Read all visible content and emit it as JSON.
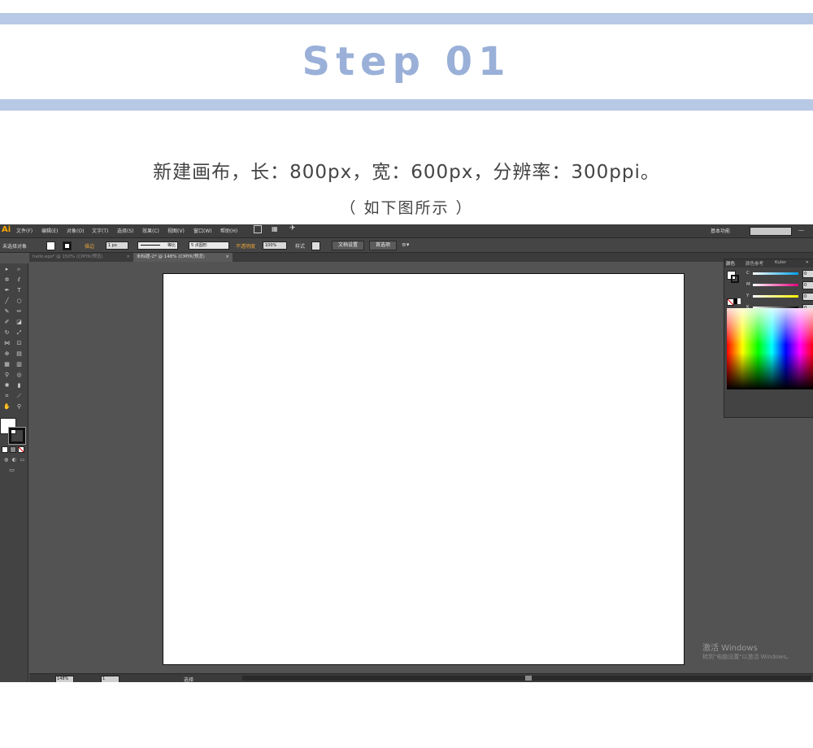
{
  "header": {
    "title": "Step 01",
    "instruction": "新建画布，长：800px，宽：600px，分辨率：300ppi。",
    "caption": "（ 如下图所示 ）"
  },
  "colors": {
    "band": "#b8c9e6",
    "title": "#9ab0d8"
  },
  "app": {
    "logo": "Ai",
    "menu": [
      "文件(F)",
      "编辑(E)",
      "对象(O)",
      "文字(T)",
      "选择(S)",
      "效果(C)",
      "视图(V)",
      "窗口(W)",
      "帮助(H)"
    ],
    "workspace": "基本功能",
    "minimize_symbol": "—",
    "control": {
      "selection": "未选择对象",
      "stroke_label": "描边",
      "stroke_weight": "1 px",
      "stroke_profile": "等比",
      "brush": "5 点圆形",
      "opacity_label": "不透明度",
      "opacity": "100%",
      "style_label": "样式",
      "doc_setup": "文档设置",
      "preferences": "首选项"
    },
    "tabs": [
      {
        "label": "hello.eps* @ 150% (CMYK/预览)",
        "close": "×",
        "active": false
      },
      {
        "label": "未标题-2* @ 148% (CMYK/预览)",
        "close": "×",
        "active": true
      }
    ],
    "color_panel": {
      "tabs": [
        "颜色",
        "颜色参考",
        "Kuler"
      ],
      "menu": "»",
      "channels": [
        {
          "label": "C",
          "value": "0",
          "color": "#00a0e9"
        },
        {
          "label": "M",
          "value": "0",
          "color": "#e4007f"
        },
        {
          "label": "Y",
          "value": "0",
          "color": "#fff100"
        },
        {
          "label": "K",
          "value": "0",
          "color": "#000000"
        }
      ]
    },
    "status": {
      "zoom": "148%",
      "page": "1",
      "tool": "选择"
    },
    "watermark": {
      "title": "激活 Windows",
      "subtitle": "转到\"电脑设置\"以激活 Windows。"
    }
  }
}
